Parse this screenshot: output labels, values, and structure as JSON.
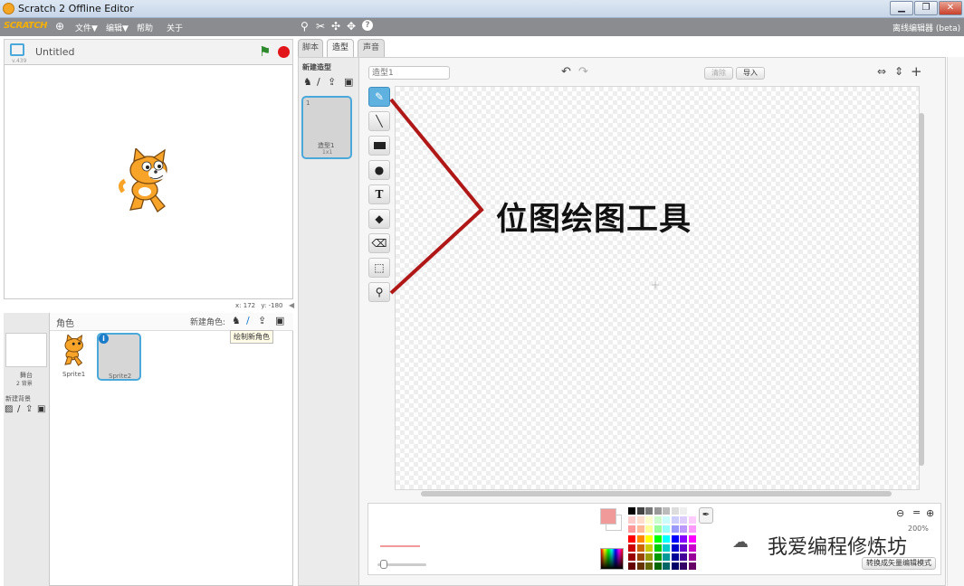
{
  "window": {
    "title": "Scratch 2 Offline Editor",
    "minimize": "▁",
    "maximize": "❐",
    "close": "✕"
  },
  "menubar": {
    "logo": "SCRATCH",
    "file": "文件▼",
    "edit": "编辑▼",
    "help": "帮助",
    "about": "关于",
    "offline_label": "离线编辑器 (beta)"
  },
  "stage": {
    "project_title": "Untitled",
    "version": "v.439",
    "coords": {
      "x_label": "x:",
      "x": "172",
      "y_label": "y:",
      "y": "-180"
    }
  },
  "sprites": {
    "header": "角色",
    "new_sprite_label": "新建角色:",
    "tooltip": "绘制新角色",
    "stage_label": "舞台",
    "stage_backdrops": "2 背景",
    "new_backdrop": "新建背景",
    "items": [
      {
        "name": "Sprite1",
        "selected": false
      },
      {
        "name": "Sprite2",
        "selected": true
      }
    ]
  },
  "tabs": [
    {
      "label": "脚本",
      "active": false
    },
    {
      "label": "造型",
      "active": true
    },
    {
      "label": "声音",
      "active": false
    }
  ],
  "costumes": {
    "new_costume_label": "新建造型",
    "items": [
      {
        "index": "1",
        "name": "造型1",
        "size": "1x1"
      }
    ]
  },
  "editor": {
    "costume_name_placeholder": "造型1",
    "clear": "清除",
    "import": "导入",
    "zoom": "200%",
    "convert": "转换成矢量编辑模式",
    "annotation": "位图绘图工具",
    "watermark": "我爱编程修炼坊",
    "active_tool": "brush",
    "tools": [
      "brush-icon",
      "line-icon",
      "rectangle-icon",
      "ellipse-icon",
      "text-icon",
      "fill-icon",
      "eraser-icon",
      "select-icon",
      "stamp-icon"
    ]
  },
  "colors": {
    "accent": "#4aa8da",
    "primary_color": "#f09a9a",
    "annotation_line": "#b01818"
  }
}
